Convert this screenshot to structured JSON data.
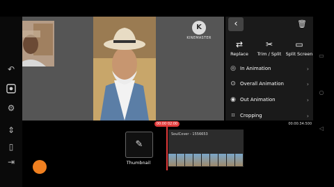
{
  "watermark": {
    "logo_letter": "K",
    "text": "KINEMASTER"
  },
  "panel": {
    "back_icon": "chevron-left-icon",
    "tools": [
      {
        "label": "Replace",
        "icon": "replace-icon"
      },
      {
        "label": "Trim / Split",
        "icon": "scissors-icon"
      },
      {
        "label": "Split Screen",
        "icon": "split-screen-icon"
      }
    ],
    "menu": [
      {
        "label": "In Animation",
        "icon": "in-animation-icon"
      },
      {
        "label": "Overall Animation",
        "icon": "overall-animation-icon"
      },
      {
        "label": "Out Animation",
        "icon": "out-animation-icon"
      },
      {
        "label": "Cropping",
        "icon": "crop-icon"
      }
    ]
  },
  "timeline": {
    "playhead_time": "00:00:02:00",
    "end_time": "00:00:34:500",
    "thumbnail_label": "Thumbnail",
    "track_name": "SoulCover - 1556653"
  }
}
